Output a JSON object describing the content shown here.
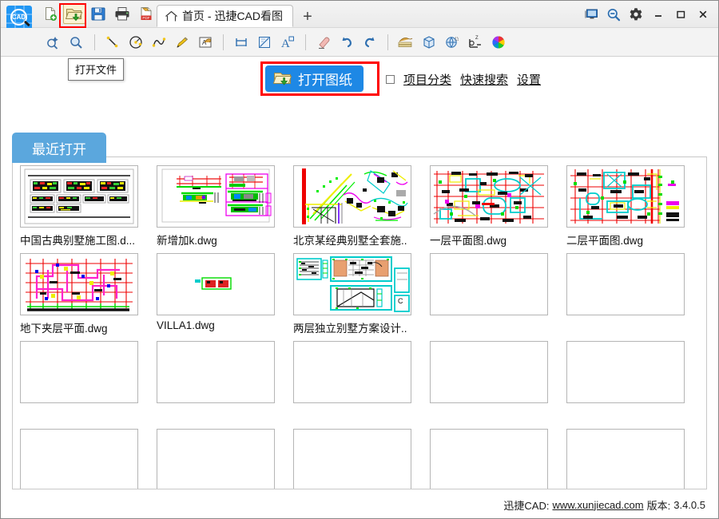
{
  "window": {
    "app_logo_text": "CAD",
    "tab_title": "首页 - 迅捷CAD看图",
    "add_tab_label": "+",
    "minimize_label": "—",
    "maximize_label": "❐",
    "close_label": "✕"
  },
  "toolbar_top": {
    "items": [
      {
        "name": "new-file-icon",
        "title": "新建文件"
      },
      {
        "name": "open-file-icon",
        "title": "打开文件",
        "highlighted": true
      },
      {
        "name": "save-icon",
        "title": "保存"
      },
      {
        "name": "print-icon",
        "title": "打印"
      },
      {
        "name": "export-pdf-icon",
        "title": "导出PDF"
      }
    ]
  },
  "tooltip": {
    "text": "打开文件"
  },
  "toolbar_second": {
    "items": [
      {
        "name": "zoom-pan-icon"
      },
      {
        "name": "zoom-window-icon"
      },
      {
        "name": "line-icon"
      },
      {
        "name": "circle-icon"
      },
      {
        "name": "spline-icon"
      },
      {
        "name": "pencil-icon"
      },
      {
        "name": "revcloud-icon"
      },
      {
        "name": "dimension-linear-icon"
      },
      {
        "name": "dimension-angle-icon"
      },
      {
        "name": "text-icon"
      },
      {
        "name": "eraser-icon"
      },
      {
        "name": "undo-icon"
      },
      {
        "name": "redo-icon"
      },
      {
        "name": "layers-icon"
      },
      {
        "name": "cube-icon"
      },
      {
        "name": "3d-view-icon"
      },
      {
        "name": "ucs-icon"
      },
      {
        "name": "color-wheel-icon"
      }
    ]
  },
  "header": {
    "open_drawing_label": "打开图纸",
    "open_drawing_icon": "folder-open-icon",
    "checkbox_checked": false,
    "links": [
      {
        "name": "project-category-link",
        "label": "项目分类"
      },
      {
        "name": "quick-search-link",
        "label": "快速搜索"
      },
      {
        "name": "settings-link",
        "label": "设置"
      }
    ]
  },
  "tabs": {
    "recent_label": "最近打开"
  },
  "files": [
    {
      "name": "中国古典别墅施工图.d...",
      "thumb": "t1",
      "empty": false
    },
    {
      "name": "新增加k.dwg",
      "thumb": "t2",
      "empty": false
    },
    {
      "name": "北京某经典别墅全套施..",
      "thumb": "t3",
      "empty": false
    },
    {
      "name": "一层平面图.dwg",
      "thumb": "t4",
      "empty": false
    },
    {
      "name": "二层平面图.dwg",
      "thumb": "t5",
      "empty": false
    },
    {
      "name": "地下夹层平面.dwg",
      "thumb": "t6",
      "empty": false
    },
    {
      "name": "VILLA1.dwg",
      "thumb": "t7",
      "empty": false
    },
    {
      "name": "两层独立别墅方案设计..",
      "thumb": "t8",
      "empty": false
    },
    {
      "name": "",
      "thumb": "",
      "empty": true
    },
    {
      "name": "",
      "thumb": "",
      "empty": true
    },
    {
      "name": "",
      "thumb": "",
      "empty": true
    },
    {
      "name": "",
      "thumb": "",
      "empty": true
    },
    {
      "name": "",
      "thumb": "",
      "empty": true
    },
    {
      "name": "",
      "thumb": "",
      "empty": true
    },
    {
      "name": "",
      "thumb": "",
      "empty": true
    },
    {
      "name": "",
      "thumb": "",
      "empty": true
    },
    {
      "name": "",
      "thumb": "",
      "empty": true
    },
    {
      "name": "",
      "thumb": "",
      "empty": true
    },
    {
      "name": "",
      "thumb": "",
      "empty": true
    },
    {
      "name": "",
      "thumb": "",
      "empty": true
    }
  ],
  "footer": {
    "brand": "迅捷CAD:",
    "url": "www.xunjiecad.com",
    "version_label": "版本:",
    "version": "3.4.0.5"
  },
  "colors": {
    "accent_blue": "#1e88e5",
    "tab_blue": "#5ba7dd",
    "highlight_red": "#ff0000",
    "panel_border": "#c8c8c8"
  }
}
